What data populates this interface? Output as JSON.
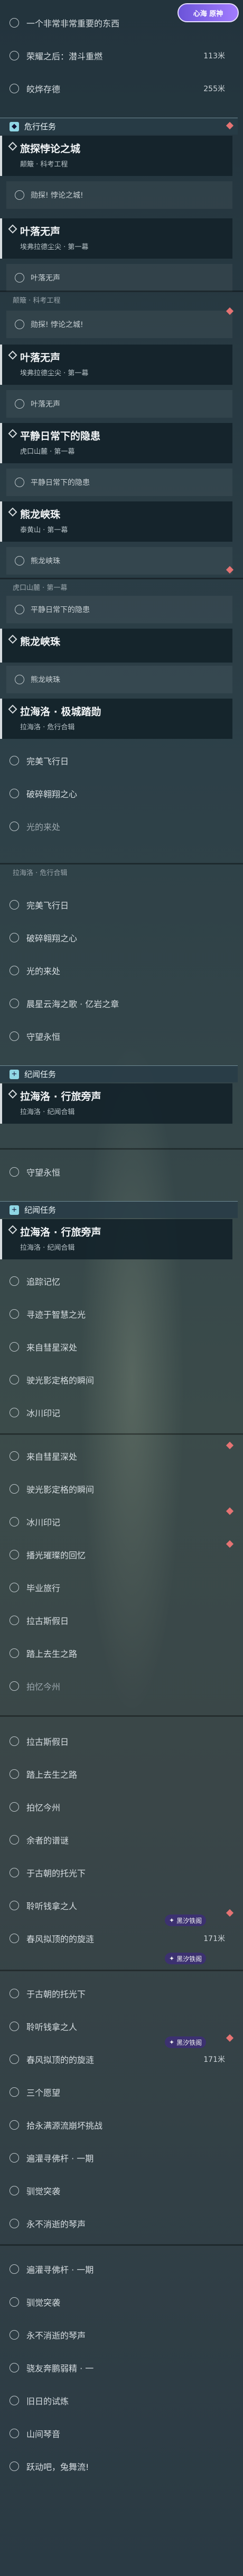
{
  "badge": "心海 原神",
  "items": [
    {
      "id": "q1",
      "label": "一个非常非常重要的东西",
      "dist": ""
    },
    {
      "id": "q2",
      "label": "荣耀之后：潜斗重燃",
      "dist": "113米"
    },
    {
      "id": "q3",
      "label": "皎烨存德",
      "dist": "255米"
    }
  ],
  "sections": {
    "s1": "危行任务",
    "s2": "纪闻任务",
    "s3": "纪闻任务"
  },
  "cards": {
    "c1": {
      "title": "旅探悖论之城",
      "sub": "颠簸 · 科考工程"
    },
    "c2": {
      "title": "叶落无声",
      "sub": "埃弗拉德尘尖 · 第一幕"
    },
    "c3": {
      "title": "叶落无声",
      "sub": "埃弗拉德尘尖 · 第一幕"
    },
    "c4": {
      "title": "平静日常下的隐患",
      "sub": "虎口山麓 · 第一幕"
    },
    "c5": {
      "title": "熊龙峡珠",
      "sub": "泰黄山 · 第一幕"
    },
    "c6": {
      "title": "熊龙峡珠",
      "sub": ""
    },
    "c7": {
      "title": "拉海洛 · 极城踏勋",
      "sub": "拉海洛 · 危行合辑"
    },
    "c8": {
      "title": "拉海洛 · 行旅旁声",
      "sub": "拉海洛 · 纪闻合辑"
    },
    "c9": {
      "title": "拉海洛 · 行旅旁声",
      "sub": "拉海洛 · 纪闻合辑"
    }
  },
  "subs": {
    "a1": "勋探! 悖论之城!",
    "a2": "勋探! 悖论之城!",
    "a3": "叶落无声",
    "a4": "平静日常下的隐患",
    "a5": "虎口山麓 · 第一幕",
    "a6": "平静日常下的隐患",
    "a7": "熊龙峡珠"
  },
  "texts": {
    "t_header1": "颠簸 · 科考工程",
    "t1": "完美飞行日",
    "t2": "破碎翱翔之心",
    "t3": "光的来处",
    "t4": "完美飞行日",
    "t5": "破碎翱翔之心",
    "t6": "光的来处",
    "t7": "晨星云海之歌 · 亿岩之章",
    "t8": "守望永恒",
    "t9": "拉海洛 · 危行合辑",
    "t10": "守望永恒",
    "t11": "追踪记忆",
    "t12": "寻迹于智慧之光",
    "t13": "来自彗星深处",
    "t14": "驶光影定格的瞬间",
    "t15": "冰川印记",
    "t16": "来自彗星深处",
    "t17": "驶光影定格的瞬间",
    "t18": "冰川印记",
    "t19": "播光璀璨的回忆",
    "t20": "毕业旅行",
    "t21": "拉古斯假日",
    "t22": "踏上去生之路",
    "t23": "拍忆今州",
    "t24": "拉古斯假日",
    "t25": "踏上去生之路",
    "t26": "拍忆今州",
    "t27": "余者的谱谜",
    "t28": "于古朝的托光下",
    "t29": "聆听钱拿之人",
    "t30": "春风拟顶的的旋涟",
    "t31": "于古朝的托光下",
    "t32": "聆听钱拿之人",
    "t33": "春风拟顶的的旋涟",
    "t34": "三个愿望",
    "t35": "拾永满源流崩坏挑战",
    "t36": "遍灌寻佛杆 · 一期",
    "t37": "驯觉突袭",
    "t38": "永不消逝的琴声",
    "t39": "遍灌寻佛杆 · 一期",
    "t40": "驯觉突袭",
    "t41": "永不消逝的琴声",
    "t42": "骁友奔鹏弱精 · 一",
    "t43": "旧日的试炼",
    "t44": "山间琴音",
    "t45": "跃动吧，兔舞流!"
  },
  "dist_tags": {
    "d1": "171米",
    "d2": "171米"
  },
  "tag_labels": {
    "g1": "黑汐铁阁",
    "g2": "黑汐铁阁",
    "g3": "黑汐铁阁"
  }
}
